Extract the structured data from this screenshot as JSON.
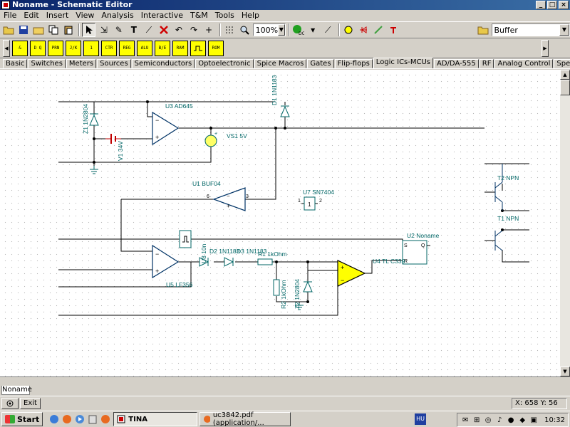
{
  "window": {
    "title": "Noname - Schematic Editor"
  },
  "menu": [
    "File",
    "Edit",
    "Insert",
    "View",
    "Analysis",
    "Interactive",
    "T&M",
    "Tools",
    "Help"
  ],
  "toolbar": {
    "zoom": "100%",
    "component_select": "Buffer",
    "icons": [
      "open-icon",
      "save-icon",
      "open-folder-icon",
      "copy-icon",
      "paste-icon",
      "pointer-icon",
      "wire-icon",
      "pen-icon",
      "text-icon",
      "ruler-icon",
      "delete-icon",
      "undo-icon",
      "redo-icon",
      "cross-icon",
      "grid-icon",
      "zoom-icon",
      "dc-analysis-icon",
      "probe-icon",
      "light-icon",
      "meter-icon",
      "diode-icon",
      "led-icon",
      "switch-icon",
      "folder-icon"
    ]
  },
  "component_bar": [
    "&",
    "D Q",
    "PRN",
    "J/K",
    "1",
    "CTR",
    "REG",
    "ALU",
    "B/E",
    "RAM",
    "ROM"
  ],
  "tabs": [
    "Basic",
    "Switches",
    "Meters",
    "Sources",
    "Semiconductors",
    "Optoelectronic",
    "Spice Macros",
    "Gates",
    "Flip-flops",
    "Logic ICs-MCUs",
    "AD/DA-555",
    "RF",
    "Analog Control",
    "Special"
  ],
  "active_tab": "Logic ICs-MCUs",
  "schematic": {
    "labels": {
      "z1": "Z1 1N2804",
      "u3": "U3 AD645",
      "d1": "D1 1N1183",
      "vs1": "VS1 5V",
      "v1": "V1 34V",
      "u1": "U1 BUF04",
      "u7": "U7 SN7404",
      "t2": "T2 NPN",
      "t1": "T1 NPN",
      "u2": "U2 Noname",
      "u5": "U5 LF356",
      "u8": "U8 10n",
      "d2": "D2 1N1183",
      "d3": "D3 1N1183",
      "r1": "R1 1kOhm",
      "r2": "R2 1kOhm",
      "z2": "Z2 1N2804",
      "u4": "U4 TL C339"
    },
    "pins": {
      "u1_in": "6",
      "u1_out": "3",
      "u7_in": "1",
      "u7_out": "2",
      "u2_s": "S",
      "u2_q": "Q",
      "u2_r": "R"
    }
  },
  "document_tab": "Noname",
  "status": {
    "exit_label": "Exit",
    "coords": "X: 658  Y: 56"
  },
  "taskbar": {
    "start": "Start",
    "tasks": [
      "TINA",
      "uc3842.pdf (application/..."
    ],
    "language": "HU",
    "clock": "10:32"
  }
}
